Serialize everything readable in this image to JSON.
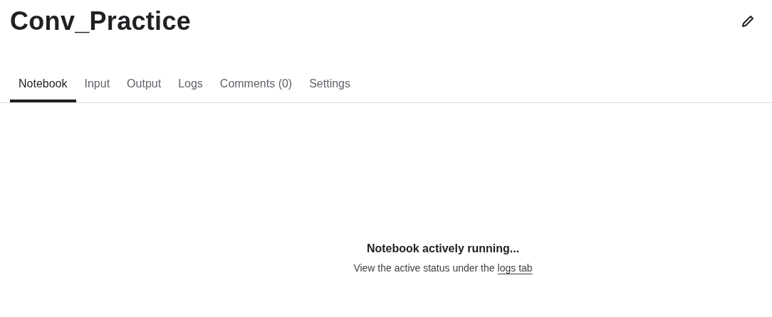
{
  "title": "Conv_Practice",
  "tabs": [
    {
      "label": "Notebook",
      "selected": true
    },
    {
      "label": "Input",
      "selected": false
    },
    {
      "label": "Output",
      "selected": false
    },
    {
      "label": "Logs",
      "selected": false
    },
    {
      "label": "Comments (0)",
      "selected": false
    },
    {
      "label": "Settings",
      "selected": false
    }
  ],
  "status": {
    "heading": "Notebook actively running...",
    "message": "View the active status under the",
    "link": "logs tab"
  }
}
